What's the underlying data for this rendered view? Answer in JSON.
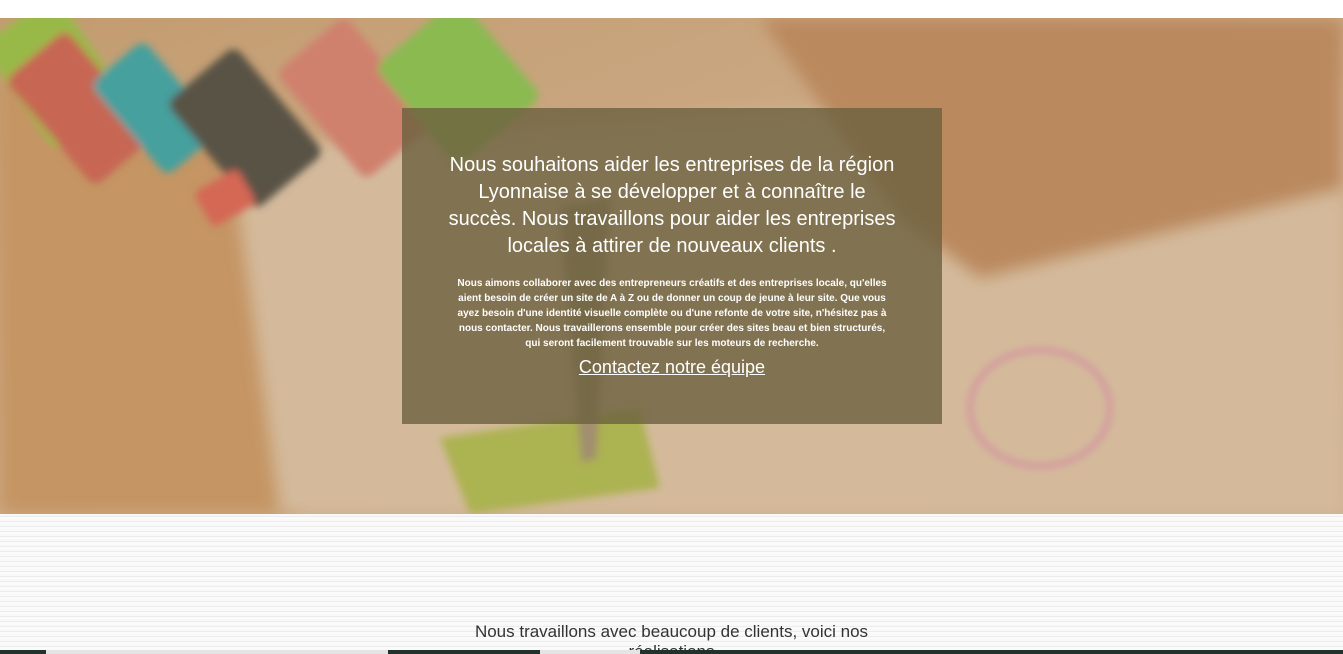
{
  "hero": {
    "heading": "Nous souhaitons aider les entreprises de la région Lyonnaise à se développer et à connaître le succès. Nous travaillons pour aider les entreprises locales à attirer de nouveaux clients .",
    "body": "Nous aimons collaborer avec des entrepreneurs créatifs et des entreprises locale, qu'elles aient besoin de créer un site de A à Z ou de donner un coup de jeune à leur site. Que vous ayez besoin d'une identité visuelle complète ou d'une refonte de votre site, n'hésitez pas à nous contacter. Nous travaillerons ensemble pour créer des sites beau et bien structurés, qui seront facilement trouvable sur les moteurs de recherche.",
    "cta_label": "Contactez notre équipe"
  },
  "clients": {
    "title": "Nous travaillons avec beaucoup de clients, voici nos réalisations"
  },
  "colors": {
    "card_background": "#6c603e",
    "hero_background": "#c8a784",
    "bottom_bar": "#1f332c"
  }
}
